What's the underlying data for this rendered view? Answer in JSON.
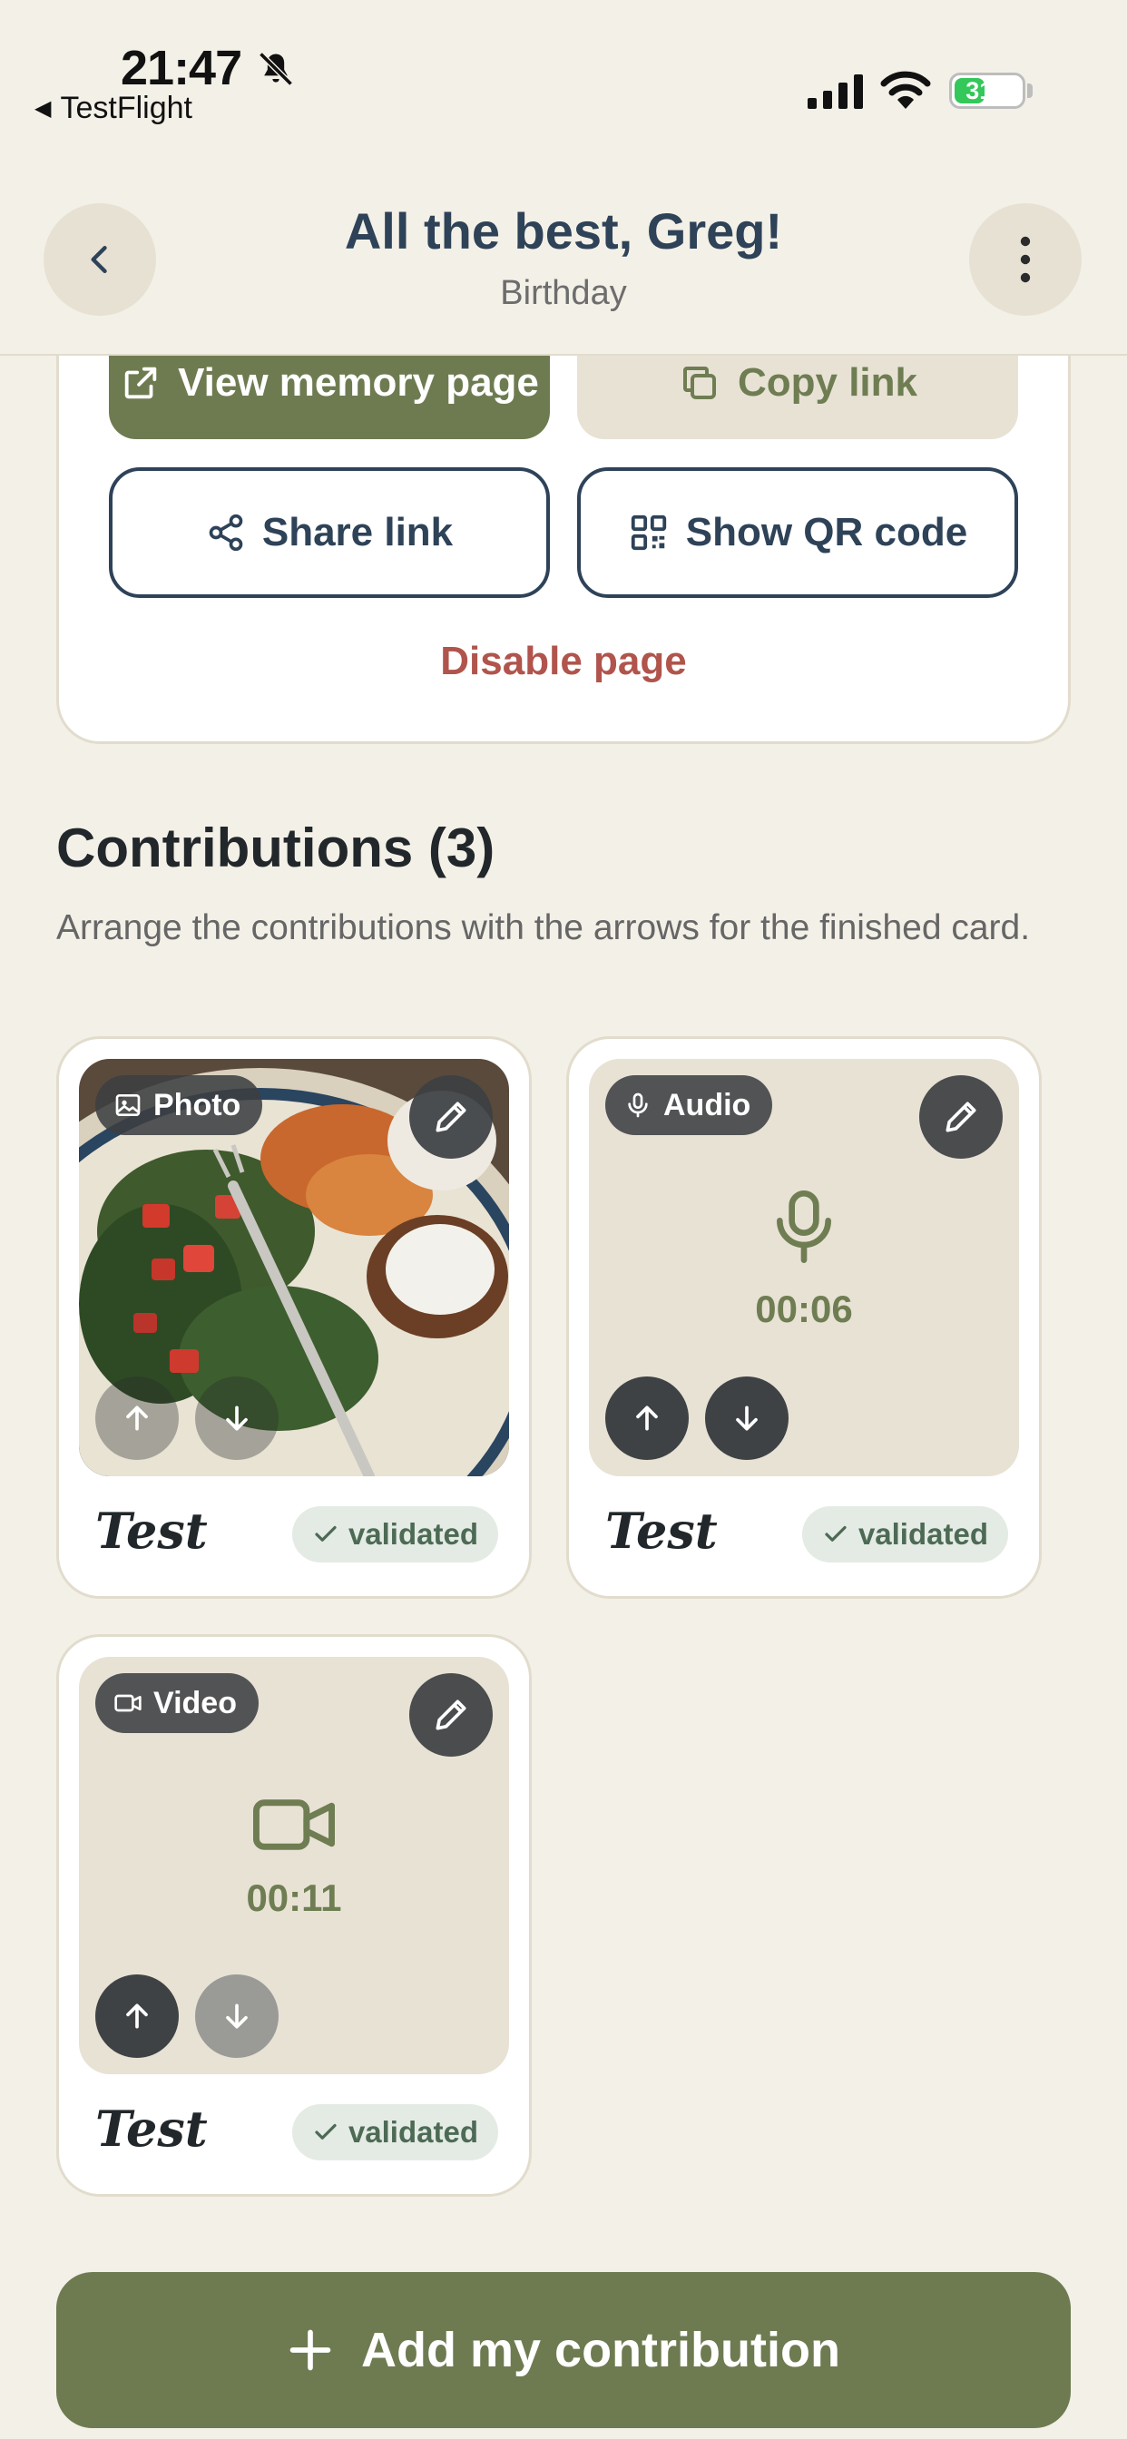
{
  "status_bar": {
    "time": "21:47",
    "back_app": "TestFlight",
    "battery_percent": "31",
    "battery_level": 0.31
  },
  "header": {
    "title": "All the best, Greg!",
    "subtitle": "Birthday"
  },
  "memory": {
    "view_label": "View memory page",
    "copy_label": "Copy link",
    "share_label": "Share link",
    "qr_label": "Show QR code",
    "disable_label": "Disable page"
  },
  "contributions": {
    "title": "Contributions (3)",
    "description": "Arrange the contributions with the arrows for the finished card.",
    "items": [
      {
        "type": "Photo",
        "author": "Test",
        "status": "validated",
        "icon": "image-icon"
      },
      {
        "type": "Audio",
        "author": "Test",
        "status": "validated",
        "duration": "00:06",
        "icon": "microphone-icon"
      },
      {
        "type": "Video",
        "author": "Test",
        "status": "validated",
        "duration": "00:11",
        "icon": "video-camera-icon"
      }
    ]
  },
  "add_button": {
    "label": "Add my contribution"
  },
  "colors": {
    "background": "#f3f0e7",
    "primary_green": "#6e7b51",
    "navy": "#2e4258",
    "danger": "#b0544c",
    "badge_bg": "#e4ebe4"
  }
}
